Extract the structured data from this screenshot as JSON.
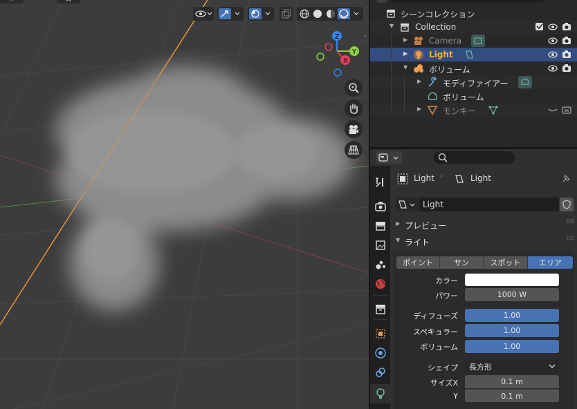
{
  "viewport": {
    "toolbar_left_glimpse": [
      "件",
      "文"
    ]
  },
  "outliner": {
    "scene_collection": "シーンコレクション",
    "items": [
      {
        "label": "Collection"
      },
      {
        "label": "Camera"
      },
      {
        "label": "Light"
      },
      {
        "label": "ボリューム"
      },
      {
        "label": "モディファイアー"
      },
      {
        "label": "ボリューム"
      },
      {
        "label": "モンキー"
      }
    ]
  },
  "properties": {
    "breadcrumb": {
      "object": "Light",
      "data": "Light"
    },
    "datablock_name": "Light",
    "panels": {
      "preview": "プレビュー",
      "light": "ライト"
    },
    "light_types": [
      "ポイント",
      "サン",
      "スポット",
      "エリア"
    ],
    "active_light_type": "エリア",
    "fields": {
      "color_label": "カラー",
      "power_label": "パワー",
      "power_value": "1000 W",
      "diffuse_label": "ディフューズ",
      "diffuse_value": "1.00",
      "specular_label": "スペキュラー",
      "specular_value": "1.00",
      "volume_label": "ボリューム",
      "volume_value": "1.00",
      "shape_label": "シェイプ",
      "shape_value": "長方形",
      "size_x_label": "サイズX",
      "size_x_value": "0.1 m",
      "size_y_label": "Y",
      "size_y_value": "0.1 m"
    }
  },
  "colors": {
    "accent": "#4772b3",
    "selected_row": "#334d80",
    "light_name": "#ffaf29",
    "axis_x": "#e2405a",
    "axis_y": "#8cd03d",
    "axis_z": "#2f86f0"
  }
}
